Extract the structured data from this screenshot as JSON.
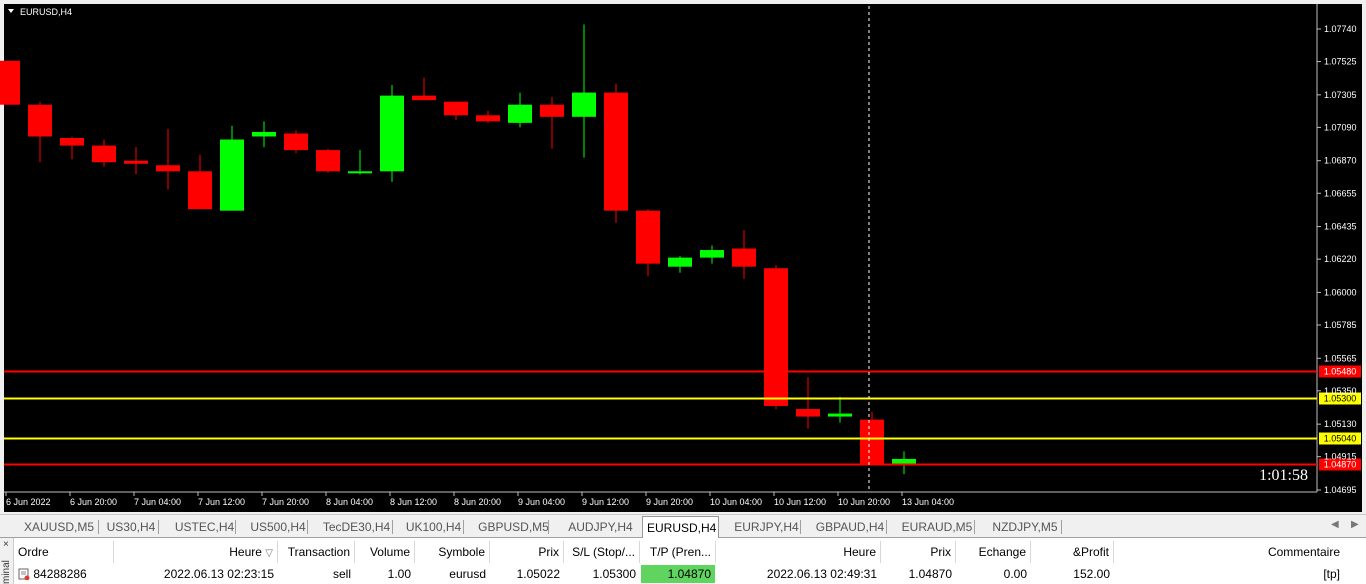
{
  "chart": {
    "title": "EURUSD,H4",
    "countdown": "1:01:58",
    "price_levels": [
      "1.07740",
      "1.07525",
      "1.07305",
      "1.07090",
      "1.06870",
      "1.06655",
      "1.06435",
      "1.06220",
      "1.06000",
      "1.05785",
      "1.05565",
      "1.05350",
      "1.05130",
      "1.04915",
      "1.04695"
    ],
    "time_labels": [
      "6 Jun 2022",
      "6 Jun 20:00",
      "7 Jun 04:00",
      "7 Jun 12:00",
      "7 Jun 20:00",
      "8 Jun 04:00",
      "8 Jun 12:00",
      "8 Jun 20:00",
      "9 Jun 04:00",
      "9 Jun 12:00",
      "9 Jun 20:00",
      "10 Jun 04:00",
      "10 Jun 12:00",
      "10 Jun 20:00",
      "13 Jun 04:00"
    ],
    "hlines": [
      {
        "price": 1.0548,
        "label": "1.05480",
        "color": "#ff0000",
        "tag_bg": "#ff0000",
        "tag_fg": "#ffffff"
      },
      {
        "price": 1.053,
        "label": "1.05300",
        "color": "#ffff00",
        "tag_bg": "#ffff00",
        "tag_fg": "#000000"
      },
      {
        "price": 1.0504,
        "label": "1.05040",
        "color": "#ffff00",
        "tag_bg": "#ffff00",
        "tag_fg": "#000000"
      },
      {
        "price": 1.0487,
        "label": "1.04870",
        "color": "#ff0000",
        "tag_bg": "#ff0000",
        "tag_fg": "#ffffff"
      }
    ],
    "bull_color": "#00ff00",
    "bear_color": "#ff0000",
    "background": "#000000",
    "candles": [
      {
        "o": 1.0753,
        "h": 1.0753,
        "l": 1.0724,
        "c": 1.0724
      },
      {
        "o": 1.0724,
        "h": 1.0726,
        "l": 1.0686,
        "c": 1.0703
      },
      {
        "o": 1.0702,
        "h": 1.0703,
        "l": 1.0688,
        "c": 1.0697
      },
      {
        "o": 1.0697,
        "h": 1.0701,
        "l": 1.0683,
        "c": 1.0686
      },
      {
        "o": 1.0687,
        "h": 1.0696,
        "l": 1.0678,
        "c": 1.0685
      },
      {
        "o": 1.0684,
        "h": 1.0708,
        "l": 1.0668,
        "c": 1.068
      },
      {
        "o": 1.068,
        "h": 1.0691,
        "l": 1.0655,
        "c": 1.0655
      },
      {
        "o": 1.0654,
        "h": 1.071,
        "l": 1.0654,
        "c": 1.0701
      },
      {
        "o": 1.0703,
        "h": 1.0713,
        "l": 1.0696,
        "c": 1.0706
      },
      {
        "o": 1.0705,
        "h": 1.0707,
        "l": 1.0692,
        "c": 1.0694
      },
      {
        "o": 1.0694,
        "h": 1.0695,
        "l": 1.0679,
        "c": 1.068
      },
      {
        "o": 1.0679,
        "h": 1.0694,
        "l": 1.0678,
        "c": 1.068
      },
      {
        "o": 1.068,
        "h": 1.0737,
        "l": 1.0673,
        "c": 1.073
      },
      {
        "o": 1.073,
        "h": 1.0742,
        "l": 1.0727,
        "c": 1.0727
      },
      {
        "o": 1.0726,
        "h": 1.0726,
        "l": 1.0714,
        "c": 1.0717
      },
      {
        "o": 1.0717,
        "h": 1.072,
        "l": 1.0712,
        "c": 1.0713
      },
      {
        "o": 1.0712,
        "h": 1.0732,
        "l": 1.0709,
        "c": 1.0724
      },
      {
        "o": 1.0724,
        "h": 1.0729,
        "l": 1.0695,
        "c": 1.0716
      },
      {
        "o": 1.0716,
        "h": 1.0777,
        "l": 1.0689,
        "c": 1.0732
      },
      {
        "o": 1.0732,
        "h": 1.0738,
        "l": 1.0646,
        "c": 1.0654
      },
      {
        "o": 1.0654,
        "h": 1.0655,
        "l": 1.0611,
        "c": 1.0619
      },
      {
        "o": 1.0617,
        "h": 1.0624,
        "l": 1.0613,
        "c": 1.0623
      },
      {
        "o": 1.0623,
        "h": 1.0631,
        "l": 1.0619,
        "c": 1.0628
      },
      {
        "o": 1.0629,
        "h": 1.0641,
        "l": 1.0609,
        "c": 1.0617
      },
      {
        "o": 1.0616,
        "h": 1.0618,
        "l": 1.0523,
        "c": 1.0525
      },
      {
        "o": 1.0523,
        "h": 1.0544,
        "l": 1.051,
        "c": 1.0518
      },
      {
        "o": 1.0518,
        "h": 1.0531,
        "l": 1.0514,
        "c": 1.052
      },
      {
        "o": 1.0516,
        "h": 1.0521,
        "l": 1.0487,
        "c": 1.0487
      },
      {
        "o": 1.0487,
        "h": 1.0495,
        "l": 1.048,
        "c": 1.049
      }
    ]
  },
  "tabs": [
    {
      "label": "XAUUSD,M5",
      "active": false
    },
    {
      "label": "US30,H4",
      "active": false
    },
    {
      "label": "USTEC,H4",
      "active": false
    },
    {
      "label": "US500,H4",
      "active": false
    },
    {
      "label": "TecDE30,H4",
      "active": false
    },
    {
      "label": "UK100,H4",
      "active": false
    },
    {
      "label": "GBPUSD,M5",
      "active": false
    },
    {
      "label": "AUDJPY,H4",
      "active": false
    },
    {
      "label": "EURUSD,H4",
      "active": true
    },
    {
      "label": "EURJPY,H4",
      "active": false
    },
    {
      "label": "GBPAUD,H4",
      "active": false
    },
    {
      "label": "EURAUD,M5",
      "active": false
    },
    {
      "label": "NZDJPY,M5",
      "active": false
    }
  ],
  "terminal": {
    "side_label": "minal",
    "close_glyph": "×",
    "columns": [
      "Ordre",
      "Heure",
      "Transaction",
      "Volume",
      "Symbole",
      "Prix",
      "S/L (Stop/...",
      "T/P (Pren...",
      "Heure",
      "Prix",
      "Echange",
      "&Profit",
      "Commentaire"
    ],
    "sort_indicator": "▽",
    "row": {
      "ordre": "84288286",
      "heure": "2022.06.13 02:23:15",
      "transaction": "sell",
      "volume": "1.00",
      "symbole": "eurusd",
      "prix": "1.05022",
      "sl": "1.05300",
      "tp": "1.04870",
      "heure2": "2022.06.13 02:49:31",
      "prix2": "1.04870",
      "echange": "0.00",
      "profit": "152.00",
      "commentaire": "[tp]"
    }
  }
}
